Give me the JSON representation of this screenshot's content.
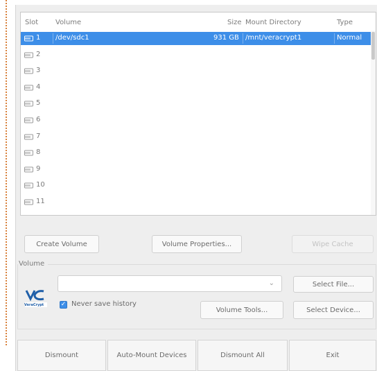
{
  "list": {
    "columns": {
      "slot": "Slot",
      "volume": "Volume",
      "size": "Size",
      "mount_directory": "Mount Directory",
      "type": "Type"
    },
    "rows": [
      {
        "slot": "1",
        "volume": "/dev/sdc1",
        "size": "931 GB",
        "mount_directory": "/mnt/veracrypt1",
        "type": "Normal",
        "selected": true
      },
      {
        "slot": "2",
        "volume": "",
        "size": "",
        "mount_directory": "",
        "type": ""
      },
      {
        "slot": "3",
        "volume": "",
        "size": "",
        "mount_directory": "",
        "type": ""
      },
      {
        "slot": "4",
        "volume": "",
        "size": "",
        "mount_directory": "",
        "type": ""
      },
      {
        "slot": "5",
        "volume": "",
        "size": "",
        "mount_directory": "",
        "type": ""
      },
      {
        "slot": "6",
        "volume": "",
        "size": "",
        "mount_directory": "",
        "type": ""
      },
      {
        "slot": "7",
        "volume": "",
        "size": "",
        "mount_directory": "",
        "type": ""
      },
      {
        "slot": "8",
        "volume": "",
        "size": "",
        "mount_directory": "",
        "type": ""
      },
      {
        "slot": "9",
        "volume": "",
        "size": "",
        "mount_directory": "",
        "type": ""
      },
      {
        "slot": "10",
        "volume": "",
        "size": "",
        "mount_directory": "",
        "type": ""
      },
      {
        "slot": "11",
        "volume": "",
        "size": "",
        "mount_directory": "",
        "type": ""
      }
    ]
  },
  "actions": {
    "create_volume": "Create Volume",
    "volume_properties": "Volume Properties...",
    "wipe_cache": "Wipe Cache"
  },
  "volume_group": {
    "label": "Volume",
    "path_value": "",
    "select_file": "Select File...",
    "never_save_history": "Never save history",
    "volume_tools": "Volume Tools...",
    "select_device": "Select Device...",
    "logo_text": "VeraCrypt"
  },
  "bottom": {
    "dismount": "Dismount",
    "auto_mount": "Auto-Mount Devices",
    "dismount_all": "Dismount All",
    "exit": "Exit"
  },
  "colors": {
    "selection": "#3d8ee8",
    "logo_blue": "#1f5fa8",
    "dotted_edge": "#d8803a"
  },
  "icons": {
    "drive": "drive-icon",
    "dropdown": "chevron-down-icon",
    "checkbox": "checkmark-icon"
  }
}
